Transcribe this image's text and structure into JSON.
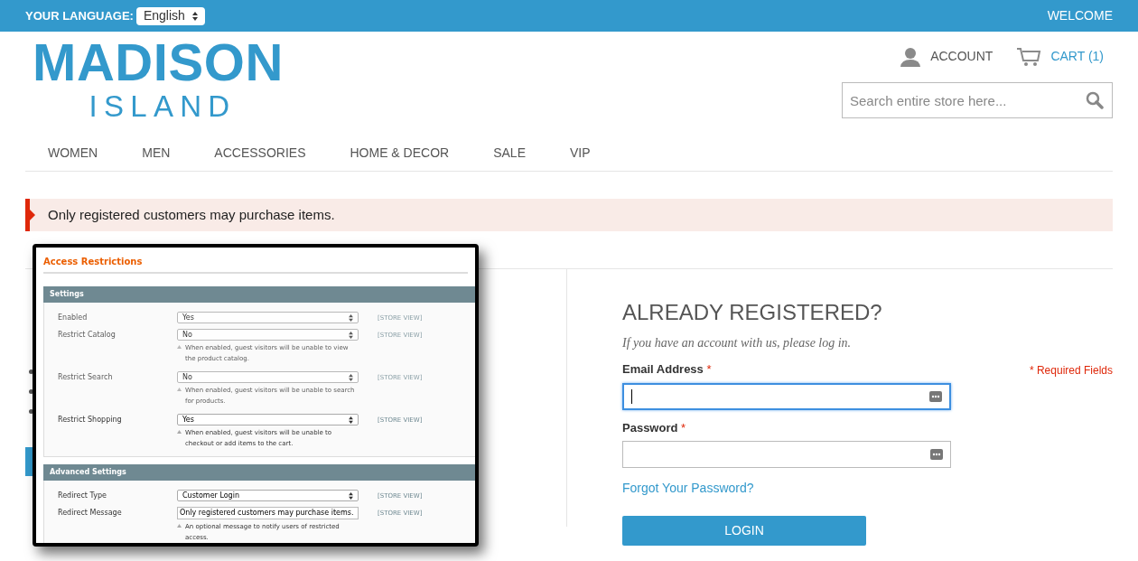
{
  "top_bar": {
    "language_label": "YOUR LANGUAGE:",
    "language_value": "English",
    "welcome": "WELCOME"
  },
  "logo": {
    "line_1": "MADISON",
    "line_2": "ISLAND"
  },
  "header_links": [
    {
      "kind": "account",
      "label": "ACCOUNT"
    },
    {
      "kind": "cart",
      "label": "CART (1)"
    }
  ],
  "search": {
    "placeholder": "Search entire store here..."
  },
  "nav": [
    "WOMEN",
    "MEN",
    "ACCESSORIES",
    "HOME & DECOR",
    "SALE",
    "VIP"
  ],
  "notice": "Only registered customers may purchase items.",
  "overlay": {
    "title": "Access Restrictions",
    "sections": [
      {
        "title": "Settings",
        "rows": [
          {
            "kind": "select",
            "label": "Enabled",
            "value": "Yes",
            "scope": "[STORE VIEW]",
            "blurred": true
          },
          {
            "kind": "select",
            "label": "Restrict Catalog",
            "value": "No",
            "note": "When enabled, guest visitors will be unable to view the product catalog.",
            "scope": "[STORE VIEW]",
            "blurred": true
          },
          {
            "kind": "select",
            "label": "Restrict Search",
            "value": "No",
            "note": "When enabled, guest visitors will be unable to search for products.",
            "scope": "[STORE VIEW]",
            "blurred": true
          },
          {
            "kind": "select",
            "label": "Restrict Shopping",
            "value": "Yes",
            "note": "When enabled, guest visitors will be unable to checkout or add items to the cart.",
            "scope": "[STORE VIEW]",
            "blurred": false
          }
        ]
      },
      {
        "title": "Advanced Settings",
        "rows": [
          {
            "kind": "select",
            "label": "Redirect Type",
            "value": "Customer Login",
            "scope": "[STORE VIEW]",
            "blurred": false
          },
          {
            "kind": "text",
            "label": "Redirect Message",
            "value": "Only registered customers may purchase items.",
            "note": "An optional message to notify users of restricted access.",
            "scope": "[STORE VIEW]",
            "blurred": false
          }
        ]
      }
    ]
  },
  "login": {
    "heading": "ALREADY REGISTERED?",
    "intro": "If you have an account with us, please log in.",
    "required_note": "* Required Fields",
    "fields": [
      {
        "label": "Email Address",
        "required_mark": "*",
        "focused": true
      },
      {
        "label": "Password",
        "required_mark": "*",
        "focused": false
      }
    ],
    "forgot_link": "Forgot Your Password?",
    "button": "LOGIN"
  }
}
